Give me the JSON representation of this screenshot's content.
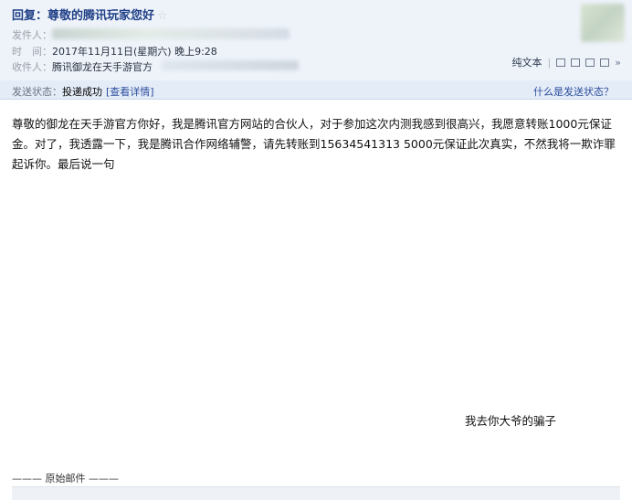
{
  "mail": {
    "subject": "回复：尊敬的腾讯玩家您好",
    "from_label": "发件人：",
    "time_label": "时　间：",
    "time_value": "2017年11月11日(星期六) 晚上9:28",
    "to_label": "收件人：",
    "to_value": "腾讯御龙在天手游官方"
  },
  "toolbar": {
    "plain_text": "纯文本"
  },
  "status": {
    "label": "发送状态：",
    "value": "投递成功",
    "detail_link": "[查看详情]",
    "help_link": "什么是发送状态？"
  },
  "content": {
    "body": "尊敬的御龙在天手游官方你好，我是腾讯官方网站的合伙人，对于参加这次内测我感到很高兴，我愿意转账1000元保证金。对了，我透露一下，我是腾讯合作网络辅警，请先转账到15634541313 5000元保证此次真实，不然我将一欺诈罪起诉你。最后说一句",
    "signature": "我去你大爷的骗子",
    "original_divider": "——— 原始邮件 ———"
  }
}
